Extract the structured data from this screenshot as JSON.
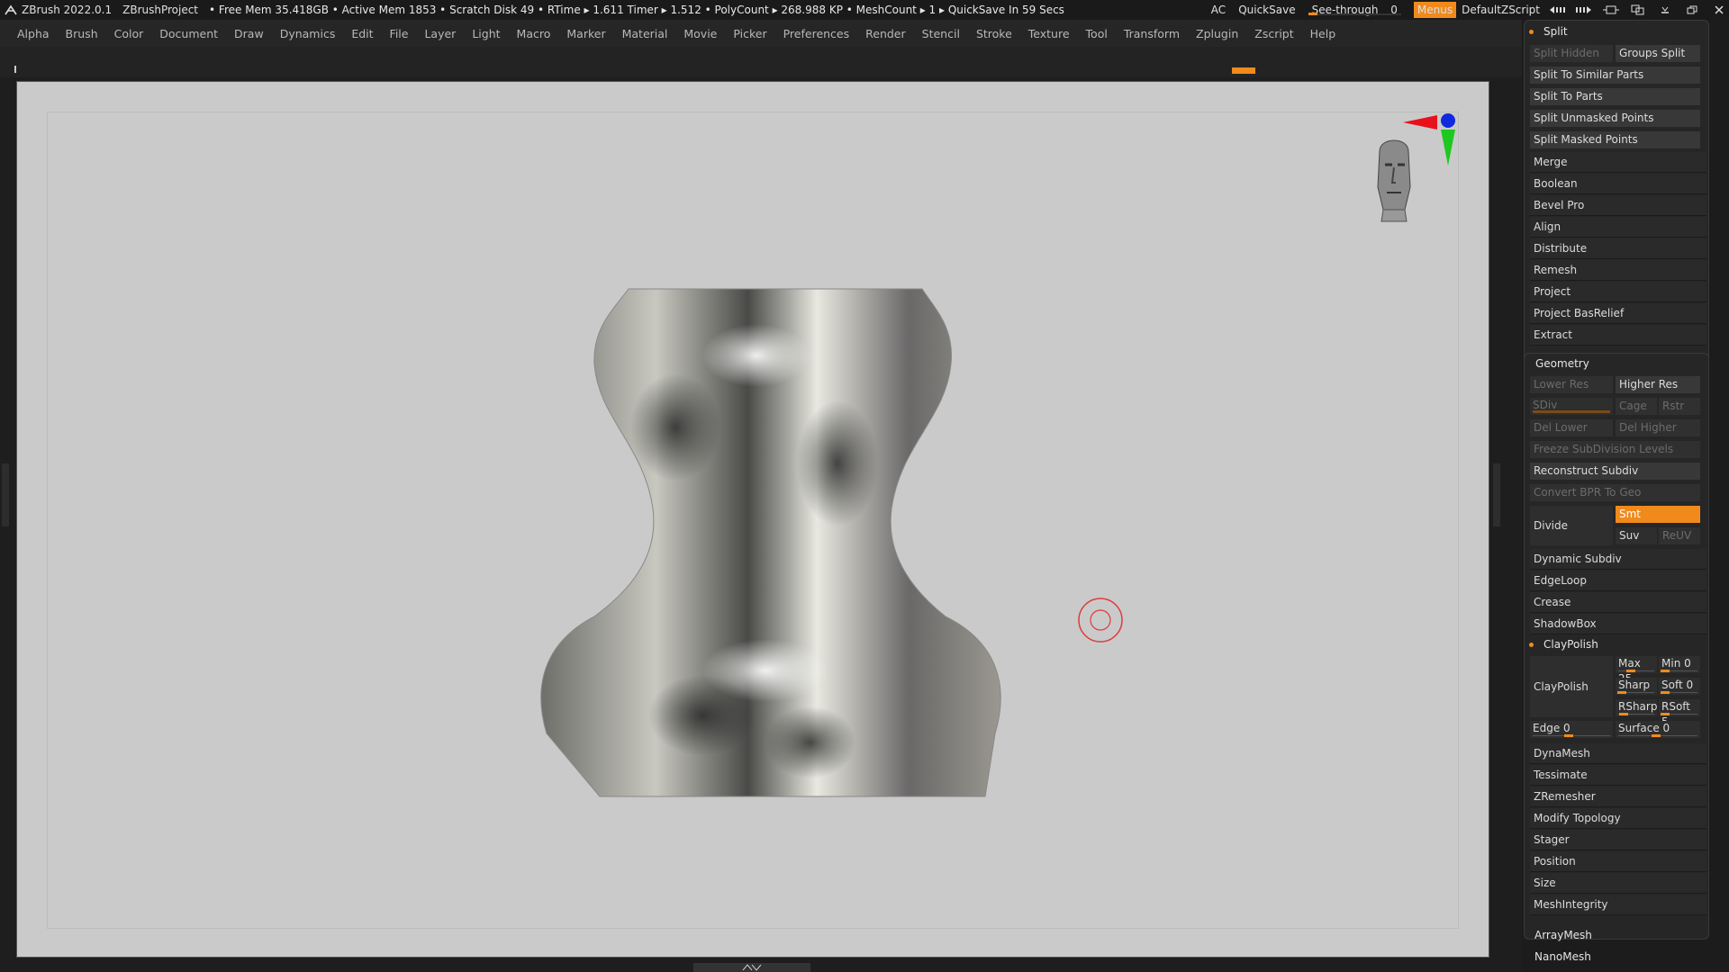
{
  "titlebar": {
    "app": "ZBrush 2022.0.1",
    "project": "ZBrushProject",
    "status": "• Free Mem 35.418GB • Active Mem 1853 • Scratch Disk 49 • RTime ▸ 1.611 Timer ▸ 1.512 • PolyCount ▸ 268.988 KP • MeshCount ▸ 1 ▸ QuickSave In 59 Secs",
    "ac": "AC",
    "quicksave": "QuickSave",
    "see_through_label": "See-through",
    "see_through_value": "0",
    "see_through_level": 0,
    "menus": "Menus",
    "script": "DefaultZScript"
  },
  "menubar": [
    "Alpha",
    "Brush",
    "Color",
    "Document",
    "Draw",
    "Dynamics",
    "Edit",
    "File",
    "Layer",
    "Light",
    "Macro",
    "Marker",
    "Material",
    "Movie",
    "Picker",
    "Preferences",
    "Render",
    "Stencil",
    "Stroke",
    "Texture",
    "Tool",
    "Transform",
    "Zplugin",
    "Zscript",
    "Help"
  ],
  "icons": {
    "logo": "zbrush-logo-icon",
    "head": "head-orientation-icon",
    "gizmo": "xyz-axis-gizmo-icon",
    "cursor": "brush-cursor-icon"
  },
  "colors": {
    "accent": "#f08a1c",
    "canvas_bg": "#cacaca",
    "panel_bg": "#262626",
    "axis_x": "#e8101a",
    "axis_y": "#1ec81e",
    "axis_z": "#1028e0"
  },
  "panel": {
    "split_header": "Split",
    "split_hidden": "Split Hidden",
    "groups_split": "Groups Split",
    "split_similar": "Split To Similar Parts",
    "split_parts": "Split To Parts",
    "split_unmasked": "Split Unmasked Points",
    "split_masked": "Split Masked Points",
    "items_a": [
      "Merge",
      "Boolean",
      "Bevel Pro",
      "Align",
      "Distribute",
      "Remesh",
      "Project",
      "Project BasRelief",
      "Extract"
    ],
    "geometry_header": "Geometry",
    "lower_res": "Lower Res",
    "higher_res": "Higher Res",
    "sdiv": "SDiv",
    "cage": "Cage",
    "rstr": "Rstr",
    "del_lower": "Del Lower",
    "del_higher": "Del Higher",
    "freeze": "Freeze SubDivision Levels",
    "reconstruct": "Reconstruct Subdiv",
    "convert_bpr": "Convert BPR To Geo",
    "divide": "Divide",
    "smt": "Smt",
    "suv": "Suv",
    "reuv": "ReUV",
    "items_b": [
      "Dynamic Subdiv",
      "EdgeLoop",
      "Crease",
      "ShadowBox"
    ],
    "claypolish_header": "ClayPolish",
    "claypolish_btn": "ClayPolish",
    "max": {
      "label": "Max",
      "value": "25"
    },
    "min": {
      "label": "Min",
      "value": "0"
    },
    "sharp": {
      "label": "Sharp",
      "value": ""
    },
    "soft": {
      "label": "Soft",
      "value": "0"
    },
    "rsharp": {
      "label": "RSharp",
      "value": ""
    },
    "rsoft": {
      "label": "RSoft",
      "value": "5"
    },
    "edge": {
      "label": "Edge",
      "value": "0"
    },
    "surface": {
      "label": "Surface",
      "value": "0"
    },
    "items_c": [
      "DynaMesh",
      "Tessimate",
      "ZRemesher",
      "Modify Topology",
      "Stager",
      "Position",
      "Size",
      "MeshIntegrity"
    ],
    "items_d": [
      "ArrayMesh",
      "NanoMesh"
    ]
  }
}
